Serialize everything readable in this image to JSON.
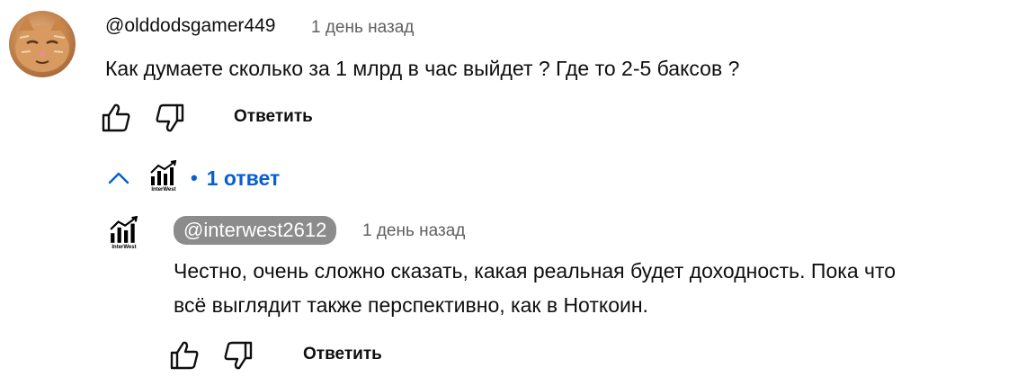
{
  "top_comment": {
    "author": "@olddodsgamer449",
    "timestamp": "1 день назад",
    "text": "Как думаете сколько за 1 млрд в час выйдет ? Где то 2-5 баксов ?",
    "reply_label": "Ответить"
  },
  "replies_toggle": {
    "separator": "•",
    "count_label": "1 ответ",
    "avatar_caption": "InterWest"
  },
  "reply": {
    "author": "@interwest2612",
    "timestamp": "1 день назад",
    "text_line1": "Честно, очень сложно сказать, какая реальная будет доходность. Пока что",
    "text_line2": "всё выглядит также перспективно, как в Ноткоин.",
    "reply_label": "Ответить",
    "avatar_caption": "InterWest"
  },
  "colors": {
    "link_blue": "#065fd4",
    "chip_gray": "#8c8c8c",
    "timestamp_gray": "#606060"
  }
}
